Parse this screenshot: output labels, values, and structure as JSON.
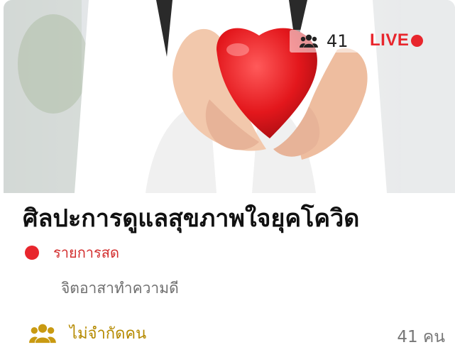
{
  "hero": {
    "image_icon": "heart-in-hands-photo",
    "watchers_icon": "people-icon",
    "watchers_count": "41",
    "live_label": "LIVE",
    "live_color": "#e8262d"
  },
  "event": {
    "title": "ศิลปะการดูแลสุขภาพใจยุคโควิด",
    "status_label": "รายการสด",
    "organizer": "จิตอาสาทำความดี",
    "capacity_icon": "people-icon",
    "capacity_label": "ไม่จำกัดคน",
    "attendee_count": "41 คน",
    "accent_color": "#b58a00"
  }
}
